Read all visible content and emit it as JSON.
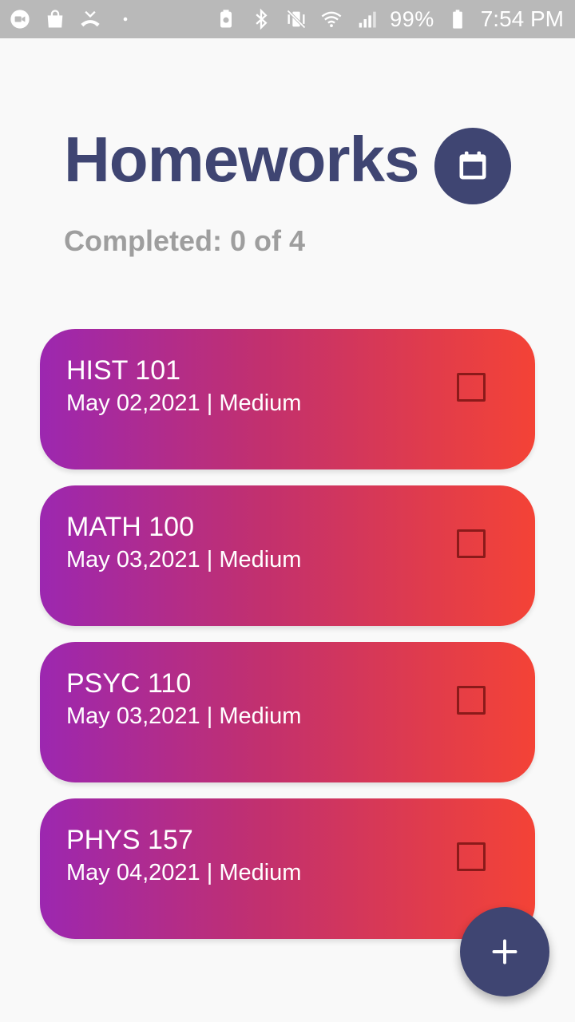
{
  "status_bar": {
    "left_icons": [
      "video-call-icon",
      "shopping-bag-icon",
      "missed-call-icon",
      "dot-icon"
    ],
    "right_icons": [
      "battery-saver-icon",
      "bluetooth-icon",
      "vibrate-mute-icon",
      "wifi-icon",
      "signal-icon"
    ],
    "battery": "99%",
    "time": "7:54 PM"
  },
  "header": {
    "title": "Homeworks",
    "completed": "Completed: 0 of 4",
    "calendar_icon": "calendar-icon"
  },
  "homeworks": [
    {
      "course": "HIST 101",
      "meta": "May 02,2021 | Medium",
      "completed": false
    },
    {
      "course": "MATH 100",
      "meta": "May 03,2021 | Medium",
      "completed": false
    },
    {
      "course": "PSYC 110",
      "meta": "May 03,2021 | Medium",
      "completed": false
    },
    {
      "course": "PHYS 157",
      "meta": "May 04,2021 | Medium",
      "completed": false
    }
  ],
  "fab": {
    "icon": "plus-icon"
  },
  "colors": {
    "primary": "#3f4572",
    "gradient_start": "#9c27b0",
    "gradient_end": "#f44336",
    "checkbox_border": "#8b1a1a"
  }
}
